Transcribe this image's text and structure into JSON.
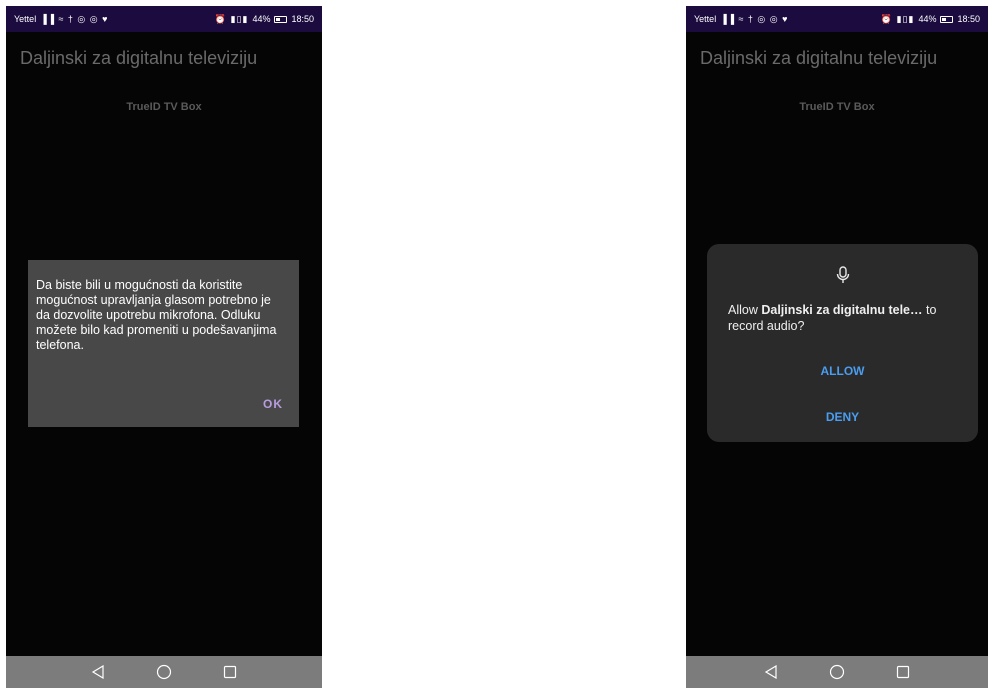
{
  "status_bar": {
    "carrier": "Yettel",
    "left_icons": "▐▐ ≈ † ◎ ◎ ♥",
    "right_icons": "⏰ ▮▯▮",
    "battery": "44%",
    "battery_level": 0.44,
    "time": "18:50"
  },
  "app": {
    "title": "Daljinski za digitalnu televiziju",
    "device_name": "TrueID TV Box"
  },
  "left_dialog": {
    "message": "Da biste bili u mogućnosti da koristite mogućnost upravljanja glasom potrebno je da dozvolite upotrebu mikrofona. Odluku možete bilo kad promeniti u podešavanjima telefona.",
    "ok_label": "OK"
  },
  "permission_dialog": {
    "prefix": "Allow ",
    "app_name": "Daljinski za digitalnu tele…",
    "suffix": " to record audio?",
    "allow_label": "ALLOW",
    "deny_label": "DENY",
    "icon": "microphone-icon"
  },
  "nav": {
    "back_icon": "back-triangle-icon",
    "home_icon": "home-circle-icon",
    "recents_icon": "recents-square-icon"
  },
  "colors": {
    "status_bar_bg": "#1b0b3f",
    "screen_bg": "#050505",
    "dialog_left_bg": "#484848",
    "dialog_right_bg": "#2a2a2a",
    "ok_accent": "#b99ce0",
    "permission_accent": "#4a9df0",
    "navbar_bg": "#7c7c7c"
  }
}
